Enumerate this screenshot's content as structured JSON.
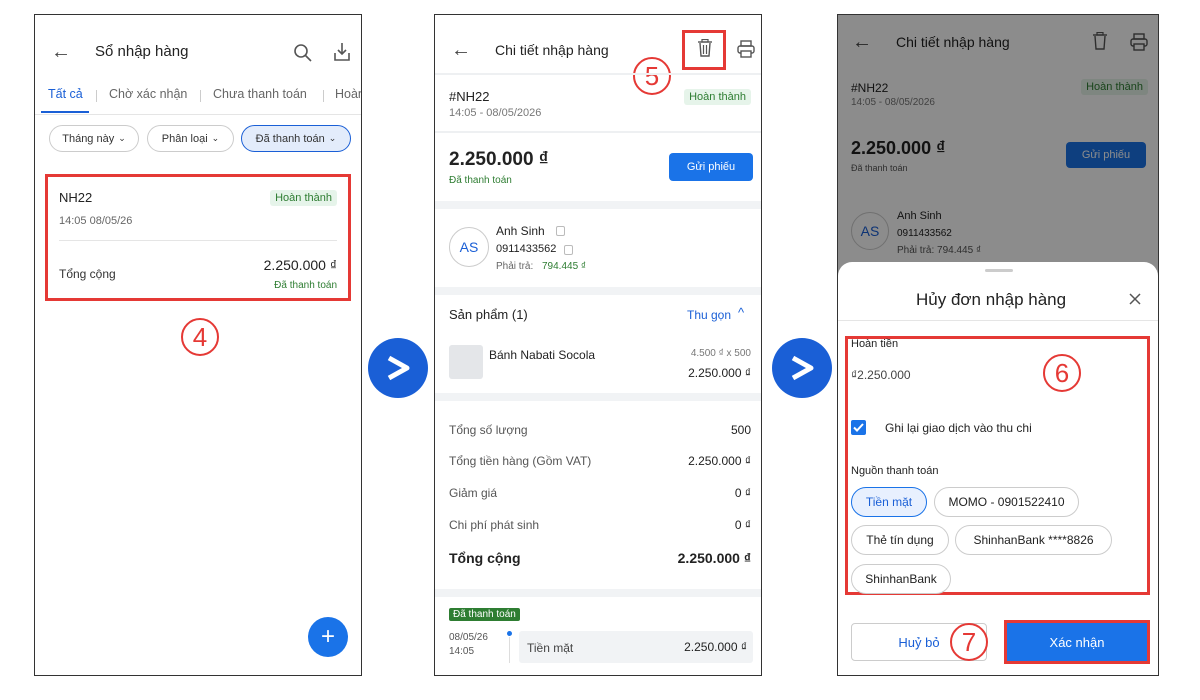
{
  "screen1": {
    "title": "Sổ nhập hàng",
    "tabs": [
      "Tất cả",
      "Chờ xác nhận",
      "Chưa thanh toán",
      "Hoàn"
    ],
    "filters": [
      "Tháng này",
      "Phân loại",
      "Đã thanh toán"
    ],
    "order": {
      "code": "NH22",
      "status": "Hoàn thành",
      "time": "14:05 08/05/26",
      "total_label": "Tổng cộng",
      "total": "2.250.000 ₫",
      "payment_status": "Đã thanh toán"
    },
    "step": "4",
    "fab": "+"
  },
  "screen2": {
    "title": "Chi tiết nhập hàng",
    "step": "5",
    "code": "#NH22",
    "status": "Hoàn thành",
    "datetime": "14:05 - 08/05/2026",
    "amount": "2.250.000 ₫",
    "paid": "Đã thanh toán",
    "send_button": "Gửi phiếu",
    "supplier": {
      "initials": "AS",
      "name": "Anh Sinh",
      "phone": "0911433562",
      "payable_label": "Phải trả:",
      "payable": "794.445 ₫"
    },
    "products_header": "Sản phẩm (1)",
    "collapse": "Thu gọn",
    "product": {
      "name": "Bánh Nabati Socola",
      "price_qty": "4.500 ₫ x 500",
      "total": "2.250.000 ₫"
    },
    "summary": [
      {
        "label": "Tổng số lượng",
        "value": "500"
      },
      {
        "label": "Tổng tiền hàng (Gồm VAT)",
        "value": "2.250.000 ₫"
      },
      {
        "label": "Giảm giá",
        "value": "0 ₫"
      },
      {
        "label": "Chi phí phát sinh",
        "value": "0 ₫"
      }
    ],
    "grand_label": "Tổng cộng",
    "grand_value": "2.250.000 ₫",
    "payment_tag": "Đã thanh toán",
    "payment_date": "08/05/26",
    "payment_time": "14:05",
    "payment_method": "Tiền mặt",
    "payment_amount": "2.250.000 ₫"
  },
  "screen3": {
    "title": "Chi tiết nhập hàng",
    "code": "#NH22",
    "status": "Hoàn thành",
    "datetime": "14:05 - 08/05/2026",
    "amount": "2.250.000 ₫",
    "paid": "Đã thanh toán",
    "send_button": "Gửi phiếu",
    "supplier_initials": "AS",
    "supplier_name": "Anh Sinh",
    "supplier_phone": "0911433562",
    "supplier_payable": "Phải trả: 794.445 ₫",
    "sheet": {
      "title": "Hủy đơn nhập hàng",
      "refund_label": "Hoàn tiền",
      "refund_value": "₫2.250.000",
      "checkbox_label": "Ghi lại giao dịch vào thu chi",
      "source_label": "Nguồn thanh toán",
      "sources": [
        "Tiền mặt",
        "MOMO - 0901522410",
        "Thẻ tín dụng",
        "ShinhanBank ****8826",
        "ShinhanBank"
      ],
      "cancel": "Huỷ bỏ",
      "confirm": "Xác nhận"
    },
    "step6": "6",
    "step7": "7"
  },
  "colors": {
    "accent": "#1a73e8",
    "highlight": "#e53935",
    "success": "#2e7d32"
  }
}
